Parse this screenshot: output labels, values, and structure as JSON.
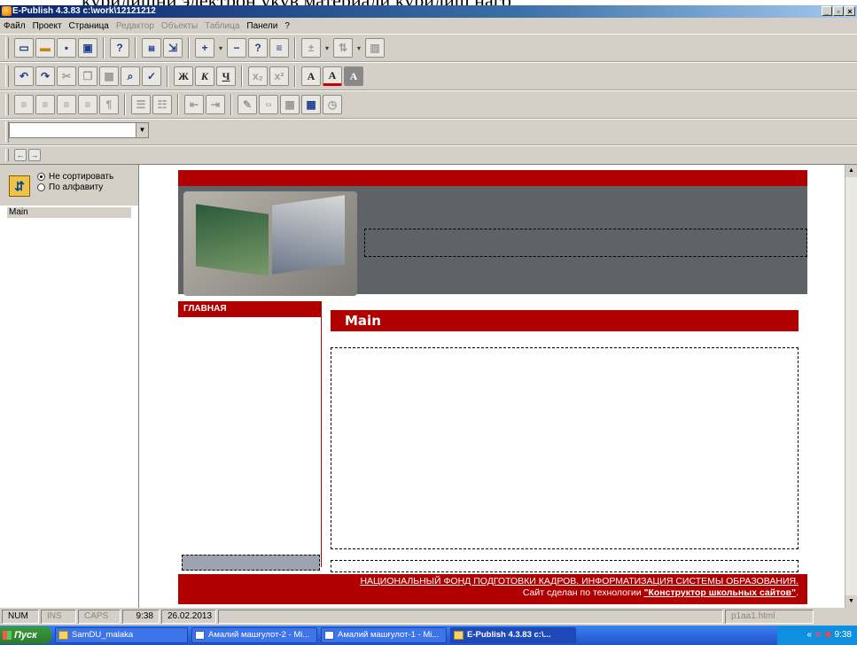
{
  "top_caption": "курилишни электрон укув материали курилиш нагб",
  "window": {
    "title": "E-Publish 4.3.83   c:\\work\\12121212",
    "buttons": [
      "_",
      "▫",
      "×"
    ]
  },
  "menu": [
    {
      "label": "Файл",
      "enabled": true
    },
    {
      "label": "Проект",
      "enabled": true
    },
    {
      "label": "Страница",
      "enabled": true
    },
    {
      "label": "Редактор",
      "enabled": false
    },
    {
      "label": "Объекты",
      "enabled": false
    },
    {
      "label": "Таблица",
      "enabled": false
    },
    {
      "label": "Панели",
      "enabled": true
    },
    {
      "label": "?",
      "enabled": true
    }
  ],
  "format_buttons": {
    "bold": "Ж",
    "italic": "К",
    "underline": "Ч",
    "font_a": "A"
  },
  "left_panel": {
    "sort_none": "Не сортировать",
    "sort_alpha": "По алфавиту",
    "pages": [
      "Main"
    ]
  },
  "site": {
    "nav_title": "ГЛАВНАЯ",
    "content_title": "Main",
    "footer_line1": "НАЦИОНАЛЬНЫЙ ФОНД ПОДГОТОВКИ КАДРОВ. ИНФОРМАТИЗАЦИЯ СИСТЕМЫ ОБРАЗОВАНИЯ.",
    "footer_line2_prefix": "Сайт сделан по технологии ",
    "footer_link": "\"Конструктор школьных сайтов\"",
    "footer_line2_suffix": ".",
    "colors": {
      "brand_red": "#b00000",
      "header_gray": "#5f6368"
    }
  },
  "status": {
    "num": "NUM",
    "ins": "INS",
    "caps": "CAPS",
    "time": "9:38",
    "date": "26.02.2013",
    "file": "p1aa1.html"
  },
  "taskbar": {
    "start": "Пуск",
    "tasks": [
      {
        "label": "SamDU_malaka",
        "active": false
      },
      {
        "label": "Амалий машғулот-2 - Mi...",
        "active": false
      },
      {
        "label": "Амалий машғулот-1 - Mi...",
        "active": false
      },
      {
        "label": "E-Publish 4.3.83   c:\\...",
        "active": true
      }
    ],
    "clock": "9:38",
    "tray_arrows": "«"
  }
}
